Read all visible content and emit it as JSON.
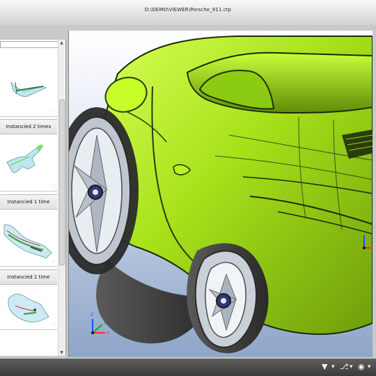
{
  "window": {
    "title": "D:\\DEMO\\VIEWER\\Porsche_911.ctp"
  },
  "panel": {
    "search_placeholder": "",
    "refresh_icon": "refresh-icon",
    "items": [
      {
        "caption": "Instancied 2 times",
        "thumbnail": "part-thumbnail"
      },
      {
        "caption": "Instancied 1 time",
        "thumbnail": "part-thumbnail"
      },
      {
        "caption": "Instancied 1 time",
        "thumbnail": "part-thumbnail"
      }
    ]
  },
  "viewport": {
    "model_color": "#a8e11a",
    "axis_labels": {
      "x": "X",
      "y": "Y",
      "z": "Z"
    }
  },
  "statusbar": {
    "icons": [
      "filter-icon",
      "hierarchy-icon",
      "eye-icon"
    ]
  }
}
